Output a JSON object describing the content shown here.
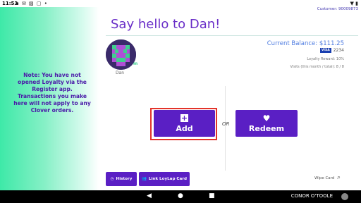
{
  "status_bar": {
    "time": "11:53",
    "icons": "▪ ✉ ▨ ▢ •"
  },
  "customer_label": "Customer: 90009873",
  "title": "Say hello to Dan!",
  "note": "Note: You have not opened Loyalty via the Register app. Transactions you make here will not apply to any Clover orders.",
  "customer": {
    "name": "Dan",
    "badge": "m",
    "balance": "Current Balance: $111.25",
    "card_brand": "VISA",
    "card_digits": "2234",
    "loyalty_reward": "Loyalty Reward: 10%",
    "visits": "Visits (this month / total): 8 / 8"
  },
  "actions": {
    "add_label": "Add",
    "or_label": "OR",
    "redeem_label": "Redeem",
    "history_label": "History",
    "link_card_label": "Link LoyLap Card",
    "wipe_card_label": "Wipe Card"
  },
  "nav_bar": {
    "user": "CONOR O'TOOLE"
  },
  "colors": {
    "accent": "#5a1fc4",
    "title": "#6a2fc8",
    "note": "#4a1aa8",
    "balance": "#4d7be0",
    "highlight_box": "#e3332a"
  }
}
